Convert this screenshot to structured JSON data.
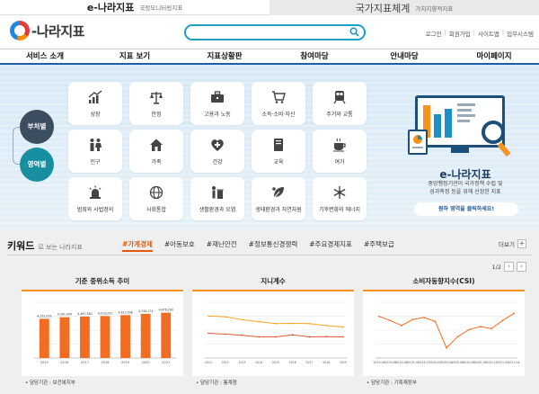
{
  "topbar": {
    "tab1": {
      "title": "e-나라지표",
      "subtitle": "국정모니터링지표"
    },
    "tab2": {
      "title": "국가지표체계",
      "subtitle": "가치지향적지표"
    }
  },
  "header": {
    "logo_text": "-나라지표",
    "search_value": "",
    "util_links": [
      "로그인",
      "회원가입",
      "사이트맵",
      "업무시스템"
    ]
  },
  "gnb": [
    "서비스 소개",
    "지표 보기",
    "지표상황판",
    "참여마당",
    "안내마당",
    "마이페이지"
  ],
  "hero": {
    "bubbles": [
      "부처별",
      "영역별"
    ],
    "tiles": [
      {
        "label": "성장",
        "icon": "growth-chart-icon"
      },
      {
        "label": "안정",
        "icon": "balance-scale-icon"
      },
      {
        "label": "고용과 노동",
        "icon": "briefcase-icon"
      },
      {
        "label": "소득·소비·자산",
        "icon": "cart-icon"
      },
      {
        "label": "주거와 교통",
        "icon": "train-icon"
      },
      {
        "label": "인구",
        "icon": "people-icon"
      },
      {
        "label": "가족",
        "icon": "home-icon"
      },
      {
        "label": "건강",
        "icon": "health-cross-icon"
      },
      {
        "label": "교육",
        "icon": "book-icon"
      },
      {
        "label": "여가",
        "icon": "coffee-cup-icon"
      },
      {
        "label": "범죄와 사법정의",
        "icon": "siren-icon"
      },
      {
        "label": "사회통합",
        "icon": "globe-icon"
      },
      {
        "label": "생활환경과 오염",
        "icon": "trash-can-icon"
      },
      {
        "label": "생태환경과 자연자원",
        "icon": "leaf-icon"
      },
      {
        "label": "기후변화와 에너지",
        "icon": "snowflake-icon"
      }
    ],
    "promo": {
      "title": "e-나라지표",
      "desc_line1": "중앙행정기관이 국가정책 수립 및",
      "desc_line2": "성과측정 등을 위해 선정한 지표",
      "button": "원하 영역을 클릭하세요!"
    }
  },
  "keyword": {
    "title": "키워드",
    "subtitle": "로 보는 나라지표",
    "tags": [
      "#가계경제",
      "#아동보호",
      "#재난안전",
      "#정보통신경쟁력",
      "#주요경제지표",
      "#주택보급"
    ],
    "active_tag": "#가계경제",
    "more": "더보기",
    "page": "1/2",
    "cards": [
      {
        "title": "기준 중위소득 추이",
        "source": "• 담당기관 : 보건복지부"
      },
      {
        "title": "지니계수",
        "source": "• 담당기관 : 통계청"
      },
      {
        "title": "소비자동향지수(CSI)",
        "source": "• 담당기관 : 기획재정부"
      }
    ]
  },
  "chart_data": [
    {
      "type": "bar",
      "categories": [
        "2015",
        "2016",
        "2017",
        "2018",
        "2019",
        "2020",
        "2021"
      ],
      "values": [
        4222533,
        4391434,
        4467380,
        4519202,
        4613536,
        4749174,
        4876290
      ],
      "data_labels": [
        "4,222,533",
        "4,391,434",
        "4,467,380",
        "4,519,202",
        "4,613,536",
        "4,749,174",
        "4,876,290"
      ],
      "title": "",
      "color": "#f26d21",
      "ylim": [
        0,
        6000000
      ]
    },
    {
      "type": "line",
      "x": [
        "2011",
        "2012",
        "2013",
        "2014",
        "2015",
        "2016",
        "2017",
        "2018",
        "2019"
      ],
      "series": [
        {
          "values": [
            0.388,
            0.385,
            0.372,
            0.363,
            0.354,
            0.355,
            0.354,
            0.345,
            0.339
          ],
          "color": "#f7a623"
        },
        {
          "values": [
            0.311,
            0.307,
            0.302,
            0.295,
            0.295,
            0.304,
            0.295,
            0.296,
            0.295
          ],
          "color": "#e05a3a"
        }
      ],
      "ylim": [
        0.2,
        0.45
      ]
    },
    {
      "type": "line",
      "x": [
        "2019.04",
        "2019.06",
        "2019.08",
        "2019.10",
        "2019.12",
        "2020.02",
        "2020.04",
        "2020.06",
        "2020.08",
        "2020.10",
        "2020.12",
        "2021.02",
        "2021.04"
      ],
      "series": [
        {
          "values": [
            101,
            97,
            92,
            98,
            100,
            96,
            70,
            81,
            88,
            91,
            89,
            97,
            104
          ],
          "color": "#f26d21"
        }
      ],
      "ylim": [
        60,
        115
      ]
    }
  ],
  "colors": {
    "accent": "#1aa0c8",
    "nav_border": "#1f5fa8",
    "active_tag": "#e55a00",
    "card_border": "#f7921e"
  }
}
